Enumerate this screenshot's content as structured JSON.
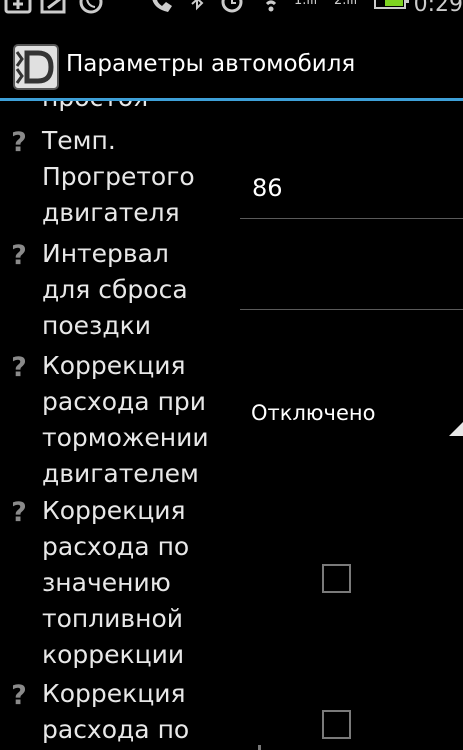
{
  "status_bar": {
    "time": "0:29",
    "signal_1": "1.ıll",
    "signal_2": "2.ıll"
  },
  "action_bar": {
    "logo_letter": "D",
    "title": "Параметры автомобиля"
  },
  "settings": {
    "clipped_label": "простоя",
    "warm_engine_temp": {
      "label": "Темп.\nПрогретого\nдвигателя",
      "value": "86"
    },
    "trip_reset_interval": {
      "label": "Интервал\nдля сброса\nпоездки",
      "value": ""
    },
    "engine_braking_correction": {
      "label": "Коррекция\nрасхода при\nторможении\nдвигателем",
      "selected": "Отключено"
    },
    "fuel_trim_correction": {
      "label": "Коррекция\nрасхода по\nзначению\nтопливной\nкоррекции",
      "checked": false
    },
    "correction_by": {
      "label": "Коррекция\nрасхода по",
      "checked": false
    }
  },
  "help_glyph": "?",
  "colors": {
    "accent": "#3ea0d8",
    "battery": "#7ed321",
    "background": "#000000"
  }
}
